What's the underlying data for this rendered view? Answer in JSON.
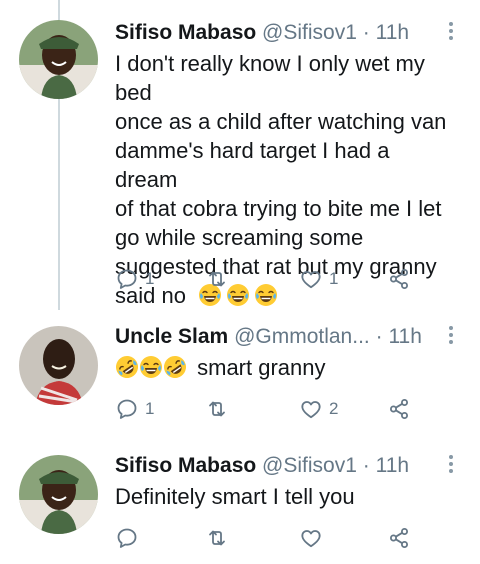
{
  "tweets": [
    {
      "name": "Sifiso Mabaso",
      "handle": "@Sifisov1",
      "separator": "·",
      "time": "11h",
      "text_lines": [
        "I don't really know I only wet my bed",
        "once as a child after watching van",
        "damme's hard target I had a dream",
        "of that cobra trying to bite me I let",
        "go while screaming some",
        "suggested that rat but my granny",
        "said no"
      ],
      "trailing_emojis": [
        "joy",
        "joy",
        "joy"
      ],
      "reply_count": "1",
      "like_count": "1"
    },
    {
      "name": "Uncle Slam",
      "handle": "@Gmmotlan...",
      "separator": "·",
      "time": "11h",
      "leading_emojis": [
        "rofl",
        "joy",
        "rofl"
      ],
      "text": "smart granny",
      "reply_count": "1",
      "like_count": "2"
    },
    {
      "name": "Sifiso Mabaso",
      "handle": "@Sifisov1",
      "separator": "·",
      "time": "11h",
      "text": "Definitely smart I tell you",
      "reply_count": "",
      "like_count": ""
    }
  ],
  "colors": {
    "text": "#14171a",
    "secondary": "#657786",
    "thread_line": "#cfd9de",
    "emoji_yellow": "#ffcc33"
  },
  "icons": [
    "reply-icon",
    "retweet-icon",
    "like-icon",
    "share-icon",
    "more-options-icon"
  ]
}
